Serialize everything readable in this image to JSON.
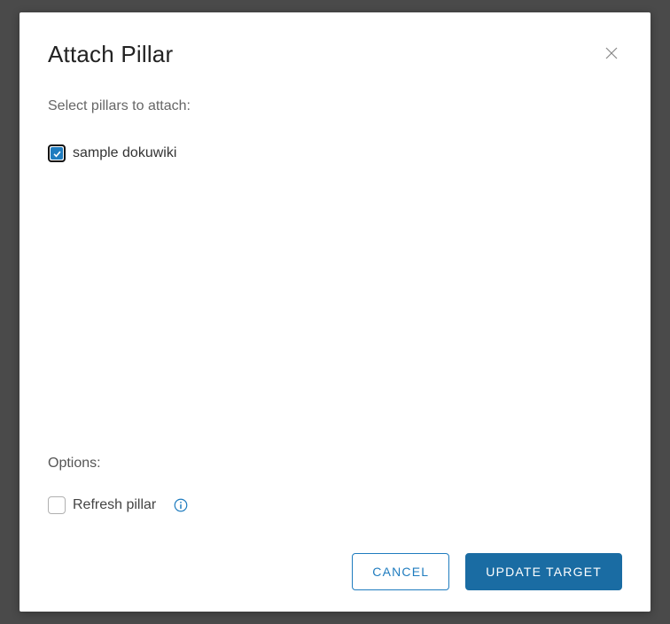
{
  "modal": {
    "title": "Attach Pillar",
    "select_label": "Select pillars to attach:",
    "pillars": [
      {
        "label": "sample dokuwiki",
        "checked": true
      }
    ],
    "options_label": "Options:",
    "options": [
      {
        "label": "Refresh pillar",
        "checked": false
      }
    ],
    "buttons": {
      "cancel": "CANCEL",
      "submit": "UPDATE TARGET"
    }
  }
}
